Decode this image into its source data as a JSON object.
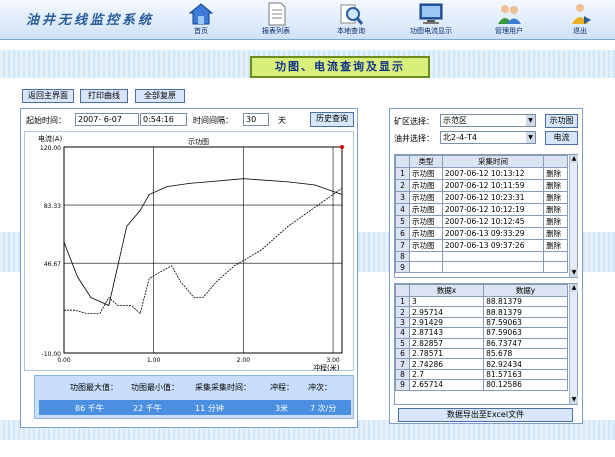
{
  "app_title": "油井无线监控系统",
  "nav": [
    {
      "label": "首页",
      "icon": "home-icon"
    },
    {
      "label": "报表列表",
      "icon": "document-icon"
    },
    {
      "label": "本地查询",
      "icon": "magnifier-icon"
    },
    {
      "label": "功图电流显示",
      "icon": "monitor-icon"
    },
    {
      "label": "管理用户",
      "icon": "users-icon"
    },
    {
      "label": "退出",
      "icon": "exit-icon"
    }
  ],
  "page_button": "功图、电流查询及显示",
  "toolbar": {
    "return_main": "返回主界面",
    "print_chart": "打印曲线",
    "chart_reset": "全部复原"
  },
  "query": {
    "start_label": "起始时间：",
    "date_value": "2007- 6-07",
    "time_value": "0:54:16",
    "interval_label": "时间间隔：",
    "interval_value": "30",
    "unit": "天",
    "history_button": "历史查询"
  },
  "chart": {
    "y_label": "电流(A)",
    "title": "示功图",
    "xlabel": "冲程(米)"
  },
  "chart_data": {
    "type": "line",
    "title": "示功图",
    "ylabel": "电流(A)",
    "xlabel": "冲程(米)",
    "ylim": [
      -10,
      120
    ],
    "yticks": [
      "120.00",
      "83.33",
      "46.67",
      "-10.00"
    ],
    "xticks": [
      "0.00",
      "1.00",
      "2.00",
      "3.00"
    ],
    "series": [
      {
        "values": [
          [
            0,
            17
          ],
          [
            0.12,
            17
          ],
          [
            0.25,
            15
          ],
          [
            0.4,
            15
          ],
          [
            0.5,
            25
          ],
          [
            0.6,
            20
          ],
          [
            0.75,
            20
          ],
          [
            0.85,
            15
          ],
          [
            0.95,
            37
          ],
          [
            1.1,
            42
          ],
          [
            1.2,
            45
          ],
          [
            1.3,
            35
          ],
          [
            1.45,
            25
          ],
          [
            1.55,
            25
          ],
          [
            1.7,
            35
          ],
          [
            1.9,
            45
          ],
          [
            2.2,
            55
          ],
          [
            2.5,
            70
          ],
          [
            2.8,
            82
          ],
          [
            3.0,
            90
          ],
          [
            3.1,
            94
          ]
        ]
      },
      {
        "values": [
          [
            0,
            60
          ],
          [
            0.15,
            38
          ],
          [
            0.3,
            25
          ],
          [
            0.5,
            20
          ],
          [
            0.7,
            70
          ],
          [
            0.85,
            80
          ],
          [
            0.95,
            90
          ],
          [
            1.15,
            95
          ],
          [
            1.4,
            97
          ],
          [
            1.6,
            98
          ],
          [
            2.0,
            100
          ],
          [
            2.5,
            98
          ],
          [
            2.8,
            96
          ],
          [
            3.0,
            92
          ],
          [
            3.1,
            90
          ]
        ]
      }
    ]
  },
  "selector": {
    "area_label": "矿区选择：",
    "area_value": "示范区",
    "well_label": "油井选择：",
    "well_value": "北2-4-T4",
    "dyno_button": "示功图",
    "current_button": "电流"
  },
  "records_table": {
    "headers": [
      "类型",
      "采集时间",
      ""
    ],
    "rows": [
      {
        "n": "1",
        "type": "示功图",
        "time": "2007-06-12 10:13:12",
        "del": "删除"
      },
      {
        "n": "2",
        "type": "示功图",
        "time": "2007-06-12 10:11:59",
        "del": "删除"
      },
      {
        "n": "3",
        "type": "示功图",
        "time": "2007-06-12 10:23:31",
        "del": "删除"
      },
      {
        "n": "4",
        "type": "示功图",
        "time": "2007-06-12 10:12:19",
        "del": "删除"
      },
      {
        "n": "5",
        "type": "示功图",
        "time": "2007-06-12 10:12:45",
        "del": "删除"
      },
      {
        "n": "6",
        "type": "示功图",
        "time": "2007-06-13 09:33:29",
        "del": "删除"
      },
      {
        "n": "7",
        "type": "示功图",
        "time": "2007-06-13 09:37:26",
        "del": "删除"
      },
      {
        "n": "8",
        "type": "",
        "time": "",
        "del": ""
      },
      {
        "n": "9",
        "type": "",
        "time": "",
        "del": ""
      }
    ]
  },
  "values_table": {
    "headers": [
      "数据x",
      "数据y"
    ],
    "rows": [
      {
        "n": "1",
        "x": "3",
        "y": "88.81379"
      },
      {
        "n": "2",
        "x": "2.95714",
        "y": "88.81379"
      },
      {
        "n": "3",
        "x": "2.91429",
        "y": "87.59063"
      },
      {
        "n": "4",
        "x": "2.87143",
        "y": "87.59063"
      },
      {
        "n": "5",
        "x": "2.82857",
        "y": "86.73747"
      },
      {
        "n": "6",
        "x": "2.78571",
        "y": "85.678"
      },
      {
        "n": "7",
        "x": "2.74286",
        "y": "82.92434"
      },
      {
        "n": "8",
        "x": "2.7",
        "y": "81.57163"
      },
      {
        "n": "9",
        "x": "2.65714",
        "y": "80.12586"
      }
    ]
  },
  "export_button": "数据导出至Excel文件",
  "info": {
    "max_label": "功图最大值：",
    "max_value": "86 千牛",
    "min_label": "功图最小值：",
    "min_value": "22 千牛",
    "time_label": "采集采集时间：",
    "time_value": "11 分钟",
    "stroke_label": "冲程：",
    "stroke_value": "3米",
    "freq_label": "冲次：",
    "freq_value": "7 次/分"
  }
}
